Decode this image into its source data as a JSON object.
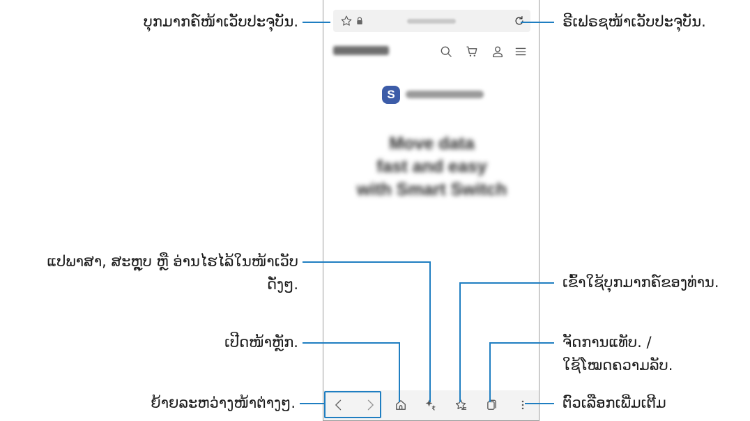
{
  "browser": {
    "url_bar": {
      "star_icon": "star-outline-icon",
      "lock_icon": "lock-icon",
      "refresh_icon": "refresh-icon"
    },
    "site_header": {
      "icons": [
        "search-icon",
        "cart-icon",
        "account-icon",
        "menu-icon"
      ]
    },
    "hero": {
      "badge_letter": "S",
      "lines": [
        "Move data",
        "fast and easy",
        "with Smart Switch"
      ]
    },
    "bottom_bar": {
      "icons": [
        "back-icon",
        "forward-icon",
        "home-icon",
        "ai-sparkle-icon",
        "bookmarks-icon",
        "tabs-icon",
        "more-icon"
      ]
    }
  },
  "callouts": {
    "bookmark_page": "ບຸກມາກຄ໌ໜ້າເວັບປະຈຸບັນ.",
    "refresh_page": "ຣີເຟຣຊໜ້າເວັບປະຈຸບັນ.",
    "translate_line1": "ແປພາສາ, ສະຫຼຸບ ຫຼື ອ່ານໄຮໄລ້ໃນໜ້າເວັບ",
    "translate_line2": "ດັ່ງໆ.",
    "open_bookmarks": "ເຂົ້າໃຊ້ບຸກມາກຄ໌ຂອງທ່ານ.",
    "open_home": "ເປີດໜ້າຫຼັກ.",
    "manage_tabs_line1": "ຈັດການແທັບ. /",
    "manage_tabs_line2": "ໃຊ້ໂໝດຄວາມລັບ.",
    "move_between_pages": "ຍ້າຍລະຫວ່າງໜ້າຕ່າງໆ.",
    "more_options": "ຕົວເລືອກເພີ່ມເຕີມ"
  },
  "colors": {
    "accent": "#1f7ec1",
    "badge": "#3c5ca8",
    "frame": "#9a9a9a"
  }
}
